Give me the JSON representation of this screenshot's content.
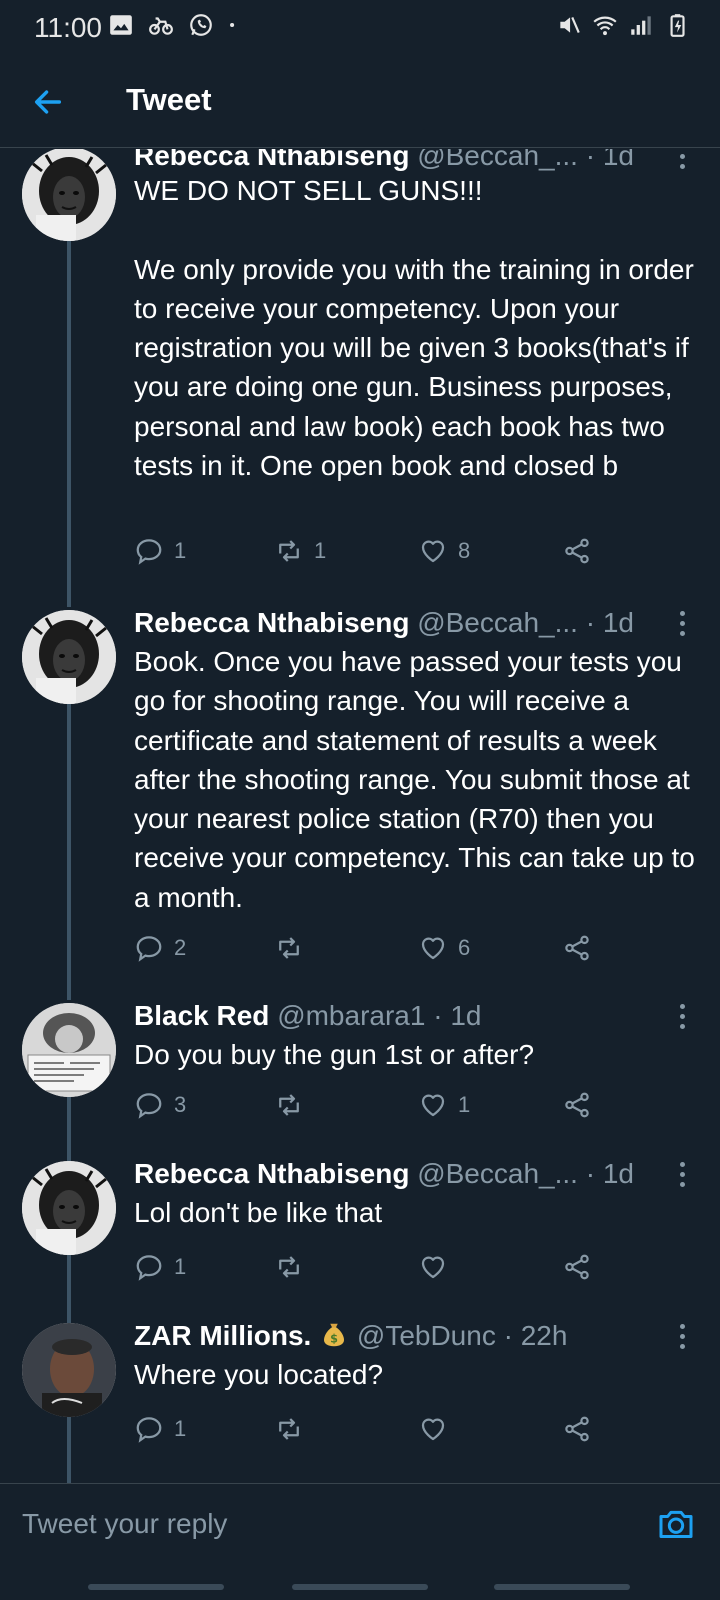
{
  "status_bar": {
    "time": "11:00",
    "left_icons": [
      "image-icon",
      "bike-icon",
      "whatsapp-icon",
      "dot-icon"
    ],
    "right_icons": [
      "mute-icon",
      "wifi-icon",
      "signal-icon",
      "battery-icon"
    ]
  },
  "header": {
    "title": "Tweet",
    "back_icon": "arrow-left-icon",
    "accent_color": "#1da1f2"
  },
  "tweets": [
    {
      "name": "Rebecca Nthabiseng",
      "meta": "@Beccah_... · 1d",
      "text": "WE DO NOT SELL GUNS!!!\n\nWe only provide you with the training in order to receive your competency. Upon your registration you will be given 3 books(that's if you are doing one gun. Business purposes, personal and law book) each book has two tests in it. One open book and closed b",
      "reply_count": "1",
      "retweet_count": "1",
      "like_count": "8"
    },
    {
      "name": "Rebecca Nthabiseng",
      "meta": "@Beccah_... · 1d",
      "text": "Book. Once you have passed your tests you go for shooting range. You will receive a certificate and statement of results a week after the shooting range. You submit those at your nearest police station (R70) then you receive your competency. This can take up to a month.",
      "reply_count": "2",
      "retweet_count": "",
      "like_count": "6"
    },
    {
      "name": "Black Red",
      "meta": "@mbarara1 · 1d",
      "text": "Do you buy the gun 1st or after?",
      "reply_count": "3",
      "retweet_count": "",
      "like_count": "1"
    },
    {
      "name": "Rebecca Nthabiseng",
      "meta": "@Beccah_... · 1d",
      "text": "Lol don't be like that",
      "reply_count": "1",
      "retweet_count": "",
      "like_count": ""
    },
    {
      "name": "ZAR Millions.",
      "name_emoji": "money-bag-icon",
      "meta": "@TebDunc · 22h",
      "text": "Where you located?",
      "reply_count": "1",
      "retweet_count": "",
      "like_count": ""
    }
  ],
  "reply": {
    "placeholder": "Tweet your reply",
    "camera_icon": "camera-icon"
  },
  "colors": {
    "background": "#15202b",
    "muted_text": "#8899a6",
    "divider": "#38444d",
    "accent": "#1da1f2"
  }
}
